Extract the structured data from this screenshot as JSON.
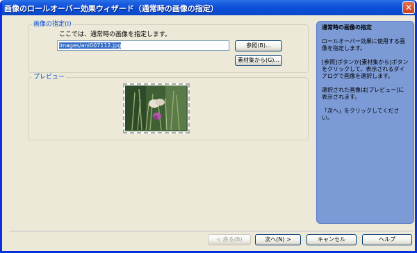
{
  "window": {
    "title": "画像のロールオーバー効果ウィザード（通常時の画像の指定）"
  },
  "image_group": {
    "legend": "画像の指定(I)",
    "description": "ここでは、通常時の画像を指定します。",
    "path_value": "images/ani007112.jpg",
    "browse_label": "参照(B)...",
    "material_label": "素材集から(G)..."
  },
  "preview_group": {
    "legend": "プレビュー"
  },
  "side_panel": {
    "heading": "通常時の画像の指定",
    "paragraphs": [
      "ロールオーバー効果に使用する画像を指定します。",
      "[参照]ボタンか[素材集から]ボタンをクリックして、表示されるダイアログで画像を選択します。",
      "選択された画像は[プレビュー]に表示されます。",
      "「次へ」をクリックしてください。"
    ]
  },
  "footer": {
    "back_label": "< 戻る(B)",
    "next_label": "次へ(N) >",
    "cancel_label": "キャンセル",
    "help_label": "ヘルプ"
  },
  "colors": {
    "title_bar": "#0b4fd8",
    "dialog_bg": "#ece9d8",
    "side_panel_bg": "#7b9ad6",
    "group_legend": "#0046d5",
    "selection": "#316ac5"
  }
}
